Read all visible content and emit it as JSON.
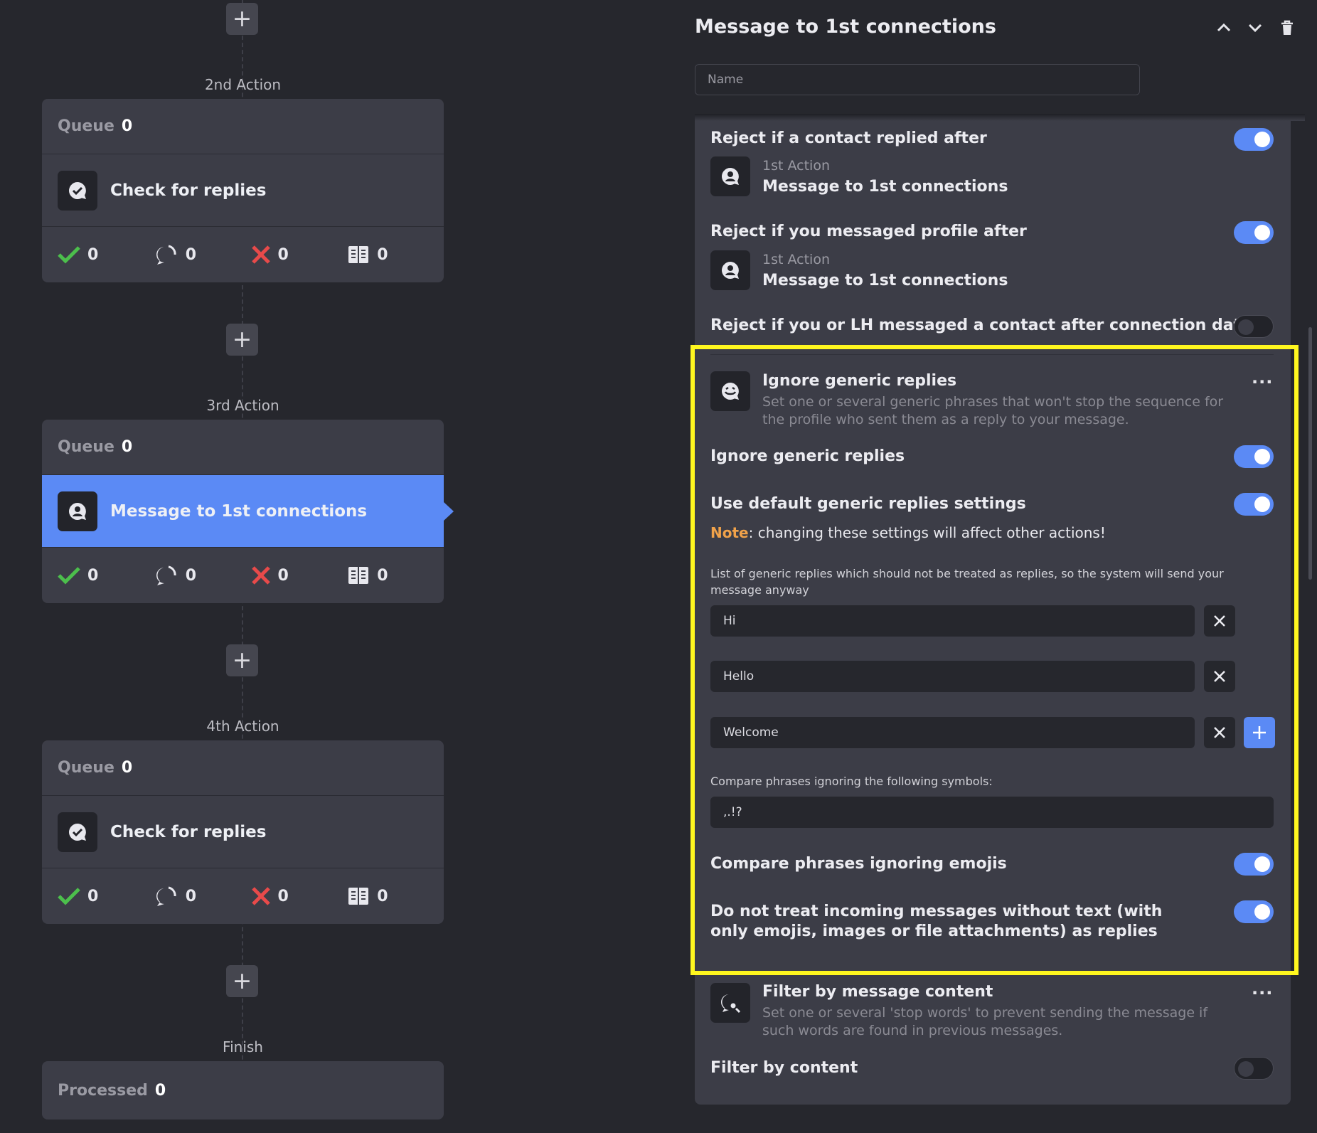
{
  "sequence": {
    "actions": [
      {
        "label": "2nd Action",
        "queue_label": "Queue",
        "queue_value": "0",
        "title": "Check for replies",
        "icon": "check-replies-icon",
        "stats": [
          "0",
          "0",
          "0",
          "0"
        ]
      },
      {
        "label": "3rd Action",
        "queue_label": "Queue",
        "queue_value": "0",
        "title": "Message to 1st connections",
        "icon": "message-contact-icon",
        "active": true,
        "stats": [
          "0",
          "0",
          "0",
          "0"
        ]
      },
      {
        "label": "4th Action",
        "queue_label": "Queue",
        "queue_value": "0",
        "title": "Check for replies",
        "icon": "check-replies-icon",
        "stats": [
          "0",
          "0",
          "0",
          "0"
        ]
      }
    ],
    "finish": {
      "label": "Finish",
      "processed_label": "Processed",
      "processed_value": "0"
    },
    "stat_icons": [
      "success-check-icon",
      "replied-bubble-icon",
      "failed-x-icon",
      "contacts-book-icon"
    ],
    "colors": {
      "accent": "#5b8af5",
      "success": "#4cbf4c",
      "fail": "#e84a4a"
    }
  },
  "panel": {
    "title": "Message to 1st connections",
    "name_placeholder": "Name",
    "reject_replied": {
      "title": "Reject if a contact replied after",
      "ref_action": "1st Action",
      "ref_title": "Message to 1st connections",
      "enabled": true
    },
    "reject_messaged": {
      "title": "Reject if you messaged profile after",
      "ref_action": "1st Action",
      "ref_title": "Message to 1st connections",
      "enabled": true
    },
    "reject_lh": {
      "title": "Reject if you or LH messaged a contact after connection date",
      "enabled": false
    },
    "generic": {
      "title": "Ignore generic replies",
      "description": "Set one or several generic phrases that won't stop the sequence for the profile who sent them as a reply to your message.",
      "toggle_label": "Ignore generic replies",
      "default_label": "Use default generic replies settings",
      "note_label": "Note",
      "note_text": ": changing these settings will affect other actions!",
      "list_label": "List of generic replies which should not be treated as replies, so the system will send your message anyway",
      "replies": [
        "Hi",
        "Hello",
        "Welcome"
      ],
      "symbols_label": "Compare phrases ignoring the following symbols:",
      "symbols_value": ",.!?",
      "emoji_label": "Compare phrases ignoring emojis",
      "no_text_label": "Do not treat incoming messages without text (with only emojis, images or file attachments) as replies",
      "highlight_color": "#fff71f"
    },
    "filter": {
      "title": "Filter by message content",
      "description": "Set one or several 'stop words' to prevent sending the message if such words are found in previous messages.",
      "toggle_label": "Filter by content",
      "enabled": false
    }
  }
}
